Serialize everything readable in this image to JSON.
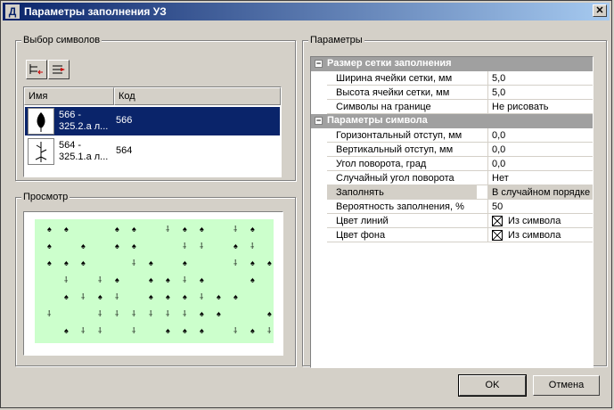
{
  "window": {
    "title": "Параметры заполнения УЗ",
    "app_icon_glyph": "Д"
  },
  "symbols_group": {
    "label": "Выбор символов",
    "columns": [
      "Имя",
      "Код"
    ],
    "rows": [
      {
        "name": "566 - 325.2.а л...",
        "code": "566",
        "selected": true
      },
      {
        "name": "564 - 325.1.а л...",
        "code": "564",
        "selected": false
      }
    ]
  },
  "preview_group": {
    "label": "Просмотр"
  },
  "params_group": {
    "label": "Параметры",
    "categories": [
      {
        "label": "Размер сетки заполнения",
        "toggle": "−",
        "rows": [
          {
            "name": "Ширина ячейки сетки, мм",
            "value": "5,0"
          },
          {
            "name": "Высота ячейки сетки, мм",
            "value": "5,0"
          },
          {
            "name": "Символы на границе",
            "value": "Не рисовать"
          }
        ]
      },
      {
        "label": "Параметры символа",
        "toggle": "−",
        "rows": [
          {
            "name": "Горизонтальный отступ, мм",
            "value": "0,0"
          },
          {
            "name": "Вертикальный отступ, мм",
            "value": "0,0"
          },
          {
            "name": "Угол поворота, град",
            "value": "0,0"
          },
          {
            "name": "Случайный угол поворота",
            "value": "Нет"
          },
          {
            "name": "Заполнять",
            "value": "В случайном порядке"
          },
          {
            "name": "Вероятность заполнения, %",
            "value": "50"
          },
          {
            "name": "Цвет линий",
            "value": "Из символа"
          },
          {
            "name": "Цвет фона",
            "value": "Из символа"
          }
        ]
      }
    ]
  },
  "buttons": {
    "ok": "OK",
    "cancel": "Отмена"
  },
  "colors": {
    "title_bar": "#0a246a",
    "preview_fill": "#ccffcc",
    "selection": "#0a246a",
    "category_bg": "#a0a0a0"
  },
  "icons": [
    "close-icon",
    "add-symbol-icon",
    "remove-symbol-icon",
    "tree-symbol-icon",
    "shrub-symbol-icon"
  ]
}
